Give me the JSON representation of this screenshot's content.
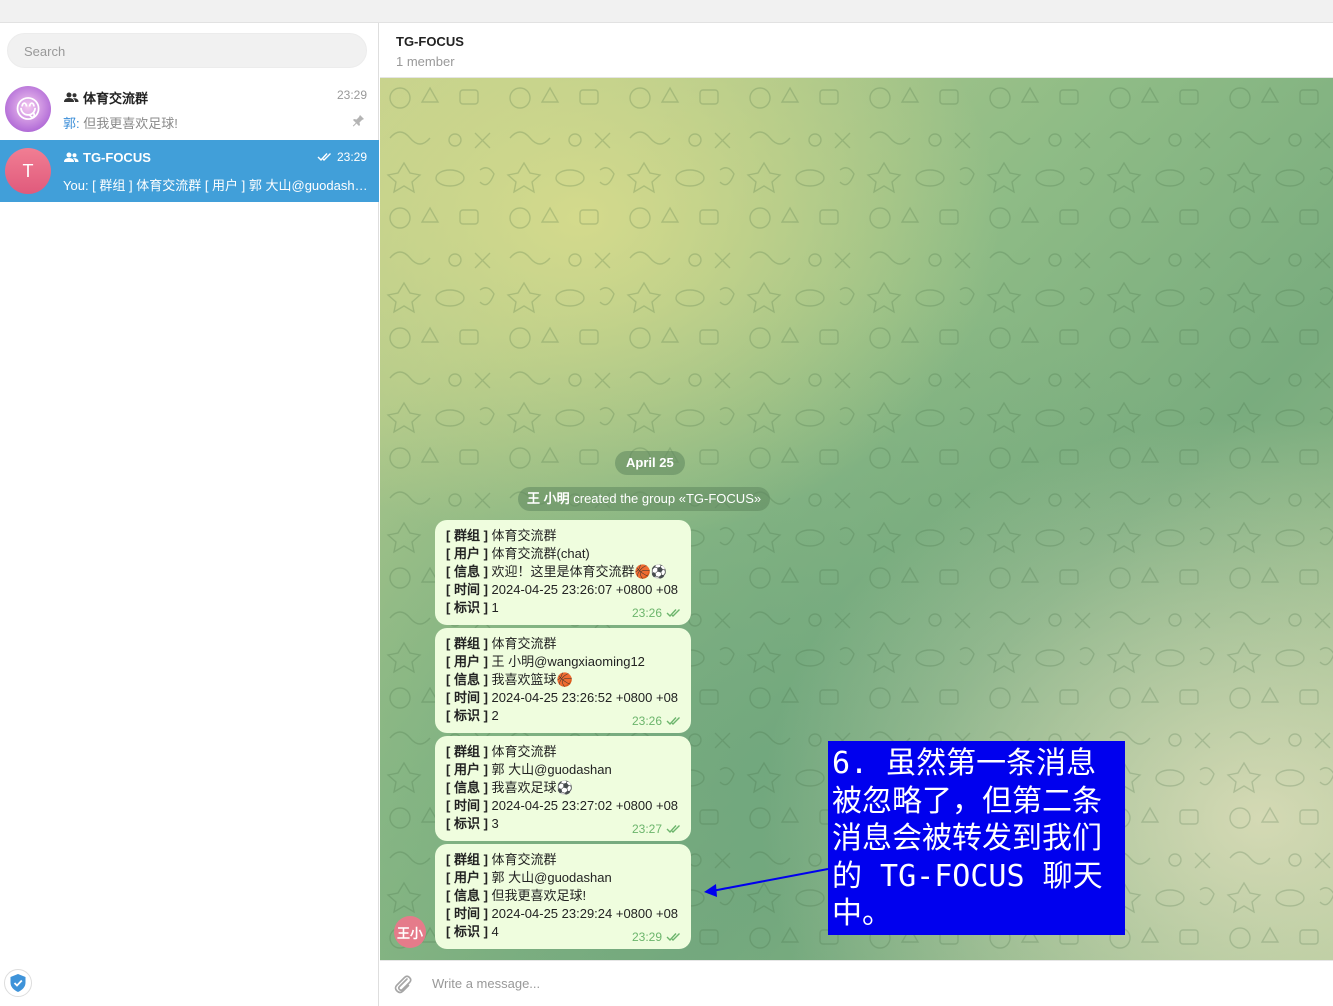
{
  "sidebar": {
    "search_placeholder": "Search",
    "chats": [
      {
        "name": "体育交流群",
        "time": "23:29",
        "sender": "郭:",
        "preview": " 但我更喜欢足球!",
        "avatar": "😋",
        "pinned": true
      },
      {
        "name": "TG-FOCUS",
        "time": "23:29",
        "preview": "You: [ 群组 ] 体育交流群 [ 用户 ] 郭 大山@guodashan",
        "avatar": "T",
        "avatar_color": "#e96a8a"
      }
    ]
  },
  "header": {
    "title": "TG-FOCUS",
    "subtitle": "1 member"
  },
  "chat": {
    "date": "April 25",
    "service_user": "王 小明",
    "service_text": " created the group «TG-FOCUS»",
    "user_avatar": "王小",
    "messages": [
      {
        "group_label": "群组",
        "group": " 体育交流群",
        "user_label": "用户",
        "user": " 体育交流群(chat)",
        "info_label": "信息",
        "info": " 欢迎！这里是体育交流群🏀⚽",
        "time_label": "时间",
        "datetime": " 2024-04-25 23:26:07 +0800 +08",
        "id_label": "标识",
        "id": " 1",
        "time": "23:26"
      },
      {
        "group_label": "群组",
        "group": " 体育交流群",
        "user_label": "用户",
        "user": " 王 小明@wangxiaoming12",
        "info_label": "信息",
        "info": " 我喜欢篮球🏀",
        "time_label": "时间",
        "datetime": " 2024-04-25 23:26:52 +0800 +08",
        "id_label": "标识",
        "id": " 2",
        "time": "23:26"
      },
      {
        "group_label": "群组",
        "group": " 体育交流群",
        "user_label": "用户",
        "user": " 郭 大山@guodashan",
        "info_label": "信息",
        "info": " 我喜欢足球⚽",
        "time_label": "时间",
        "datetime": " 2024-04-25 23:27:02 +0800 +08",
        "id_label": "标识",
        "id": " 3",
        "time": "23:27"
      },
      {
        "group_label": "群组",
        "group": " 体育交流群",
        "user_label": "用户",
        "user": " 郭 大山@guodashan",
        "info_label": "信息",
        "info": " 但我更喜欢足球!",
        "time_label": "时间",
        "datetime": " 2024-04-25 23:29:24 +0800 +08",
        "id_label": "标识",
        "id": " 4",
        "time": "23:29"
      }
    ]
  },
  "annotation": {
    "text": "6. 虽然第一条消息被忽略了，但第二条消息会被转发到我们的 TG-FOCUS 聊天中。"
  },
  "composer": {
    "placeholder": "Write a message..."
  },
  "colors": {
    "accent": "#419fd9",
    "bubble": "#effdde",
    "annotation_bg": "#0000ee",
    "check": "#6cb56c"
  }
}
